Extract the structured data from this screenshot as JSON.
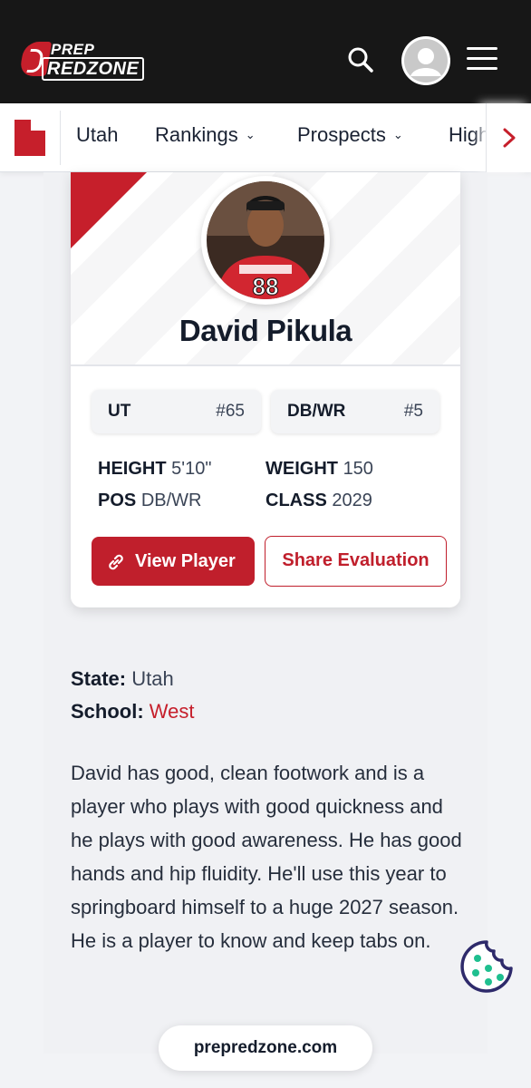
{
  "header": {
    "logo_line1": "PREP",
    "logo_line2": "REDZONE",
    "search_icon": "search-icon",
    "avatar_icon": "user-avatar-icon",
    "menu_icon": "hamburger-menu-icon"
  },
  "subnav": {
    "state_icon": "utah-state-icon",
    "items": [
      {
        "label": "Utah"
      },
      {
        "label": "Rankings"
      },
      {
        "label": "Prospects"
      },
      {
        "label": "High"
      }
    ],
    "scroll_icon": "chevron-right-icon"
  },
  "player": {
    "name": "David Pikula",
    "state_rank": {
      "label": "UT",
      "value": "#65"
    },
    "position_rank": {
      "label": "DB/WR",
      "value": "#5"
    },
    "height_label": "HEIGHT",
    "height_value": "5'10\"",
    "weight_label": "WEIGHT",
    "weight_value": "150",
    "pos_label": "POS",
    "pos_value": "DB/WR",
    "class_label": "CLASS",
    "class_value": "2029",
    "view_button": "View Player",
    "share_button": "Share Evaluation"
  },
  "info": {
    "state_label": "State:",
    "state_value": "Utah",
    "school_label": "School:",
    "school_value": "West"
  },
  "evaluation": "David has good, clean footwork and is a player who plays with good quickness and he plays with good awareness. He has good hands and hip fluidity. He'll use this year to springboard himself to a huge 2027 season. He is a player to know and keep tabs on.",
  "footer": {
    "url": "prepredzone.com",
    "cookie_icon": "cookie-icon"
  },
  "colors": {
    "brand_red": "#c61f2b",
    "topbar": "#171717",
    "cookie": "#2e2a6b",
    "cookie_dots": "#1fbf8f"
  }
}
